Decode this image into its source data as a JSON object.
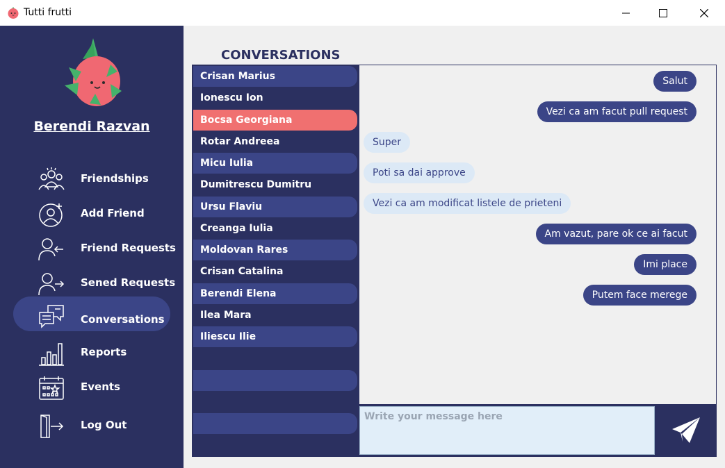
{
  "window": {
    "title": "Tutti frutti",
    "controls": [
      "minimize-icon",
      "maximize-icon",
      "close-icon"
    ]
  },
  "sidebar": {
    "username": "Berendi Razvan",
    "items": [
      {
        "label": "Friendships",
        "icon": "group-icon"
      },
      {
        "label": "Add Friend",
        "icon": "add-user-icon"
      },
      {
        "label": "Friend Requests",
        "icon": "incoming-request-icon"
      },
      {
        "label": "Sened Requests",
        "icon": "outgoing-request-icon"
      },
      {
        "label": "Conversations",
        "icon": "chat-icon",
        "active": true
      },
      {
        "label": "Reports",
        "icon": "bar-chart-icon"
      },
      {
        "label": "Events",
        "icon": "calendar-icon"
      },
      {
        "label": "Log Out",
        "icon": "logout-icon"
      }
    ]
  },
  "main": {
    "title": "CONVERSATIONS",
    "conversations": [
      "Crisan Marius",
      "Ionescu Ion",
      "Bocsa Georgiana",
      "Rotar Andreea",
      "Micu Iulia",
      "Dumitrescu Dumitru",
      "Ursu Flaviu",
      "Creanga Iulia",
      "Moldovan Rares",
      "Crisan Catalina",
      "Berendi Elena",
      "Ilea Mara",
      "Iliescu Ilie"
    ],
    "selected_conversation": "Bocsa Georgiana",
    "messages": [
      {
        "text": "Salut",
        "direction": "outgoing"
      },
      {
        "text": "Vezi ca am facut pull request",
        "direction": "outgoing"
      },
      {
        "text": "Super",
        "direction": "incoming"
      },
      {
        "text": "Poti sa dai approve",
        "direction": "incoming"
      },
      {
        "text": "Vezi ca am modificat listele de prieteni",
        "direction": "incoming"
      },
      {
        "text": "Am vazut, pare ok ce ai facut",
        "direction": "outgoing"
      },
      {
        "text": "Imi place",
        "direction": "outgoing"
      },
      {
        "text": "Putem face merege",
        "direction": "outgoing"
      }
    ],
    "composer": {
      "placeholder": "Write your message here",
      "value": "",
      "send_icon": "paper-plane-icon"
    }
  },
  "colors": {
    "sidebar_bg": "#2b3060",
    "accent": "#3b4587",
    "selected": "#f07070",
    "incoming_bubble": "#dce9f6",
    "content_bg": "#f0f0f0"
  }
}
